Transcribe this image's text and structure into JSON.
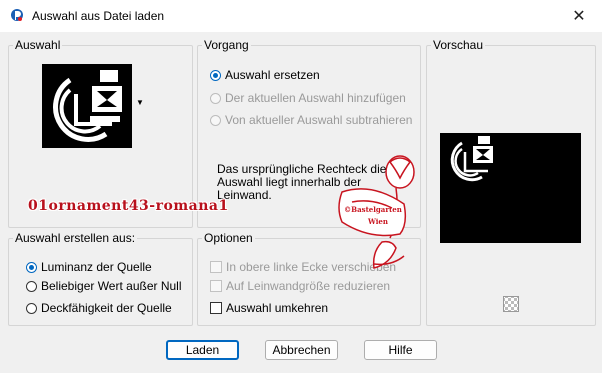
{
  "window": {
    "title": "Auswahl aus Datei laden"
  },
  "groups": {
    "auswahl": {
      "label": "Auswahl"
    },
    "vorgang": {
      "label": "Vorgang",
      "options": [
        {
          "label": "Auswahl ersetzen",
          "checked": true,
          "enabled": true
        },
        {
          "label": "Der aktuellen Auswahl hinzufügen",
          "checked": false,
          "enabled": false
        },
        {
          "label": "Von aktueller Auswahl subtrahieren",
          "checked": false,
          "enabled": false
        }
      ],
      "info_line1": "Das ursprüngliche Rechteck dieser",
      "info_line2": "Auswahl liegt innerhalb der",
      "info_line3": "Leinwand."
    },
    "vorschau": {
      "label": "Vorschau"
    },
    "erstellen": {
      "label": "Auswahl erstellen aus:",
      "options": [
        {
          "label": "Luminanz der Quelle",
          "checked": true
        },
        {
          "label": "Beliebiger Wert außer Null",
          "checked": false
        },
        {
          "label": "Deckfähigkeit der Quelle",
          "checked": false
        }
      ]
    },
    "optionen": {
      "label": "Optionen",
      "checks": [
        {
          "label": "In obere linke Ecke verschieben",
          "checked": false,
          "enabled": false
        },
        {
          "label": "Auf Leinwandgröße reduzieren",
          "checked": false,
          "enabled": false
        },
        {
          "label": "Auswahl umkehren",
          "checked": false,
          "enabled": true
        }
      ]
    }
  },
  "overlay": {
    "name": "01ornament43-romana1",
    "stamp_line1": "©Bastelgarten",
    "stamp_line2": "Wien"
  },
  "buttons": {
    "load": "Laden",
    "cancel": "Abbrechen",
    "help": "Hilfe"
  },
  "icons": {
    "app": "app-logo-icon",
    "close": "close-icon",
    "dropdown": "dropdown-arrow-icon",
    "checker": "transparency-checker-icon"
  },
  "colors": {
    "accent": "#0067c0",
    "preview_bg": "#000000",
    "watermark": "#b8101c"
  }
}
